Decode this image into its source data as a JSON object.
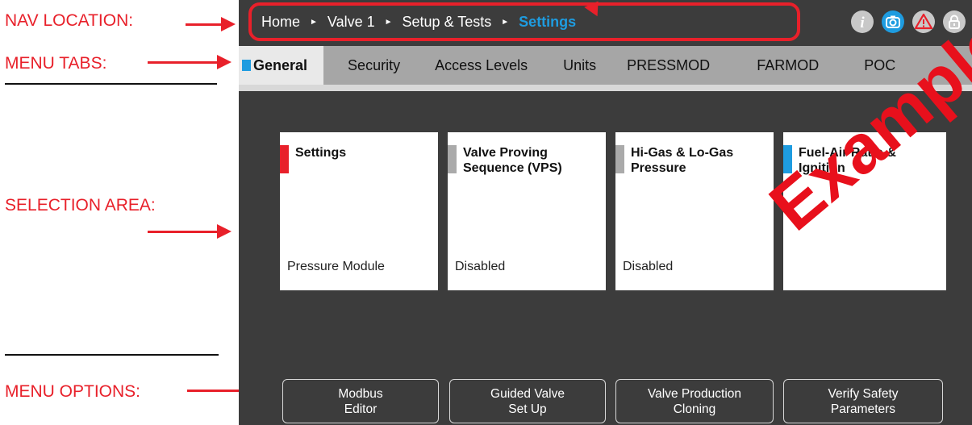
{
  "annotations": {
    "nav_location": "NAV LOCATION:",
    "menu_tabs": "MENU TABS:",
    "selection_area": "SELECTION AREA:",
    "menu_options": "MENU OPTIONS:"
  },
  "breadcrumb": [
    {
      "label": "Home"
    },
    {
      "label": "Valve 1"
    },
    {
      "label": "Setup & Tests"
    },
    {
      "label": "Settings",
      "active": true
    }
  ],
  "nav_icons": [
    "info-icon",
    "camera-icon",
    "warning-icon",
    "lock-icon"
  ],
  "tabs": [
    {
      "label": "General",
      "active": true
    },
    {
      "label": "Security"
    },
    {
      "label": "Access Levels"
    },
    {
      "label": "Units"
    },
    {
      "label": "PRESSMOD"
    },
    {
      "label": "FARMOD"
    },
    {
      "label": "POC"
    }
  ],
  "cards": [
    {
      "title": "Settings",
      "status": "Pressure Module",
      "marker_color": "#e8202a"
    },
    {
      "title": "Valve Proving Sequence (VPS)",
      "status": "Disabled",
      "marker_color": "#aaaaaa"
    },
    {
      "title": "Hi-Gas & Lo-Gas Pressure",
      "status": "Disabled",
      "marker_color": "#aaaaaa"
    },
    {
      "title": "Fuel-Air Ratio & Ignition",
      "status": "",
      "marker_color": "#1e9ce0"
    }
  ],
  "menu_options": [
    {
      "line1": "Modbus",
      "line2": "Editor"
    },
    {
      "line1": "Guided Valve",
      "line2": "Set Up"
    },
    {
      "line1": "Valve Production",
      "line2": "Cloning"
    },
    {
      "line1": "Verify Safety",
      "line2": "Parameters"
    }
  ],
  "watermark": "Example",
  "colors": {
    "accent_blue": "#1e9ce0",
    "annotation_red": "#e8202a",
    "screen_bg": "#3c3c3c"
  }
}
